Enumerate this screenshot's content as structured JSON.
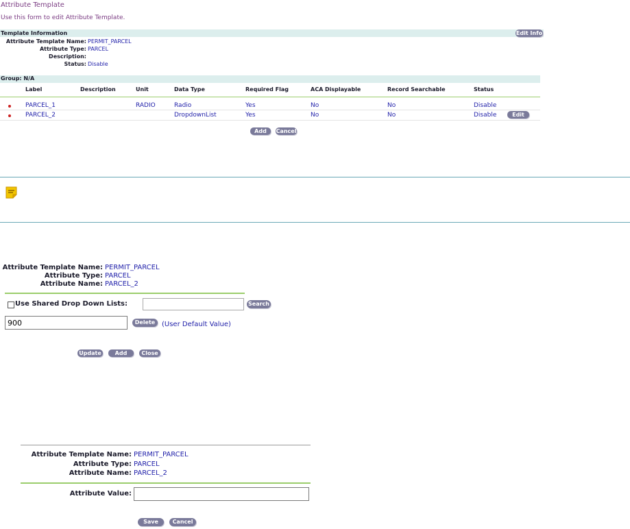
{
  "header": {
    "title": "Attribute Template",
    "subtitle": "Use this form to edit Attribute Template."
  },
  "template_info": {
    "section_title": "Template Information",
    "edit_info_button": "Edit Info",
    "fields": [
      {
        "label": "Attribute Template Name:",
        "value": "PERMIT_PARCEL"
      },
      {
        "label": "Attribute Type:",
        "value": "PARCEL"
      },
      {
        "label": "Description:",
        "value": ""
      },
      {
        "label": "Status:",
        "value": "Disable"
      }
    ]
  },
  "group": {
    "title": "Group: N/A",
    "columns": [
      "Label",
      "Description",
      "Unit",
      "Data Type",
      "Required Flag",
      "ACA Displayable",
      "Record Searchable",
      "Status"
    ],
    "rows": [
      {
        "label": "PARCEL_1",
        "description": "",
        "unit": "RADIO",
        "data_type": "Radio",
        "required": "Yes",
        "aca": "No",
        "searchable": "No",
        "status": "Disable"
      },
      {
        "label": "PARCEL_2",
        "description": "",
        "unit": "",
        "data_type": "DropdownList",
        "required": "Yes",
        "aca": "No",
        "searchable": "No",
        "status": "Disable",
        "edit": "Edit"
      }
    ],
    "add_button": "Add",
    "cancel_button": "Cancel"
  },
  "note": {
    "icon": "note-icon",
    "icon_color": "#f2c500"
  },
  "dropdown_panel": {
    "fields": [
      {
        "label": "Attribute Template Name:",
        "value": "PERMIT_PARCEL"
      },
      {
        "label": "Attribute Type:",
        "value": "PARCEL"
      },
      {
        "label": "Attribute Name:",
        "value": "PARCEL_2"
      }
    ],
    "shared_label": "Use Shared Drop Down Lists:",
    "shared_checked": false,
    "search_value": "",
    "search_button": "Search",
    "option_value": "900",
    "delete_button": "Delete",
    "default_note": "(User Default Value)",
    "update_button": "Update",
    "add_button": "Add",
    "close_button": "Close"
  },
  "value_panel": {
    "fields": [
      {
        "label": "Attribute Template Name:",
        "value": "PERMIT_PARCEL"
      },
      {
        "label": "Attribute Type:",
        "value": "PARCEL"
      },
      {
        "label": "Attribute Name:",
        "value": "PARCEL_2"
      }
    ],
    "value_label": "Attribute Value:",
    "value": "",
    "save_button": "Save",
    "cancel_button": "Cancel"
  },
  "colors": {
    "accent": "#7a3b82",
    "link": "#2222aa",
    "section_bg": "#dceeed",
    "green_rule": "#9acd6a",
    "teal_rule": "#6aa8b6",
    "bullet": "#cc2222",
    "button": "#7a7a9a"
  }
}
